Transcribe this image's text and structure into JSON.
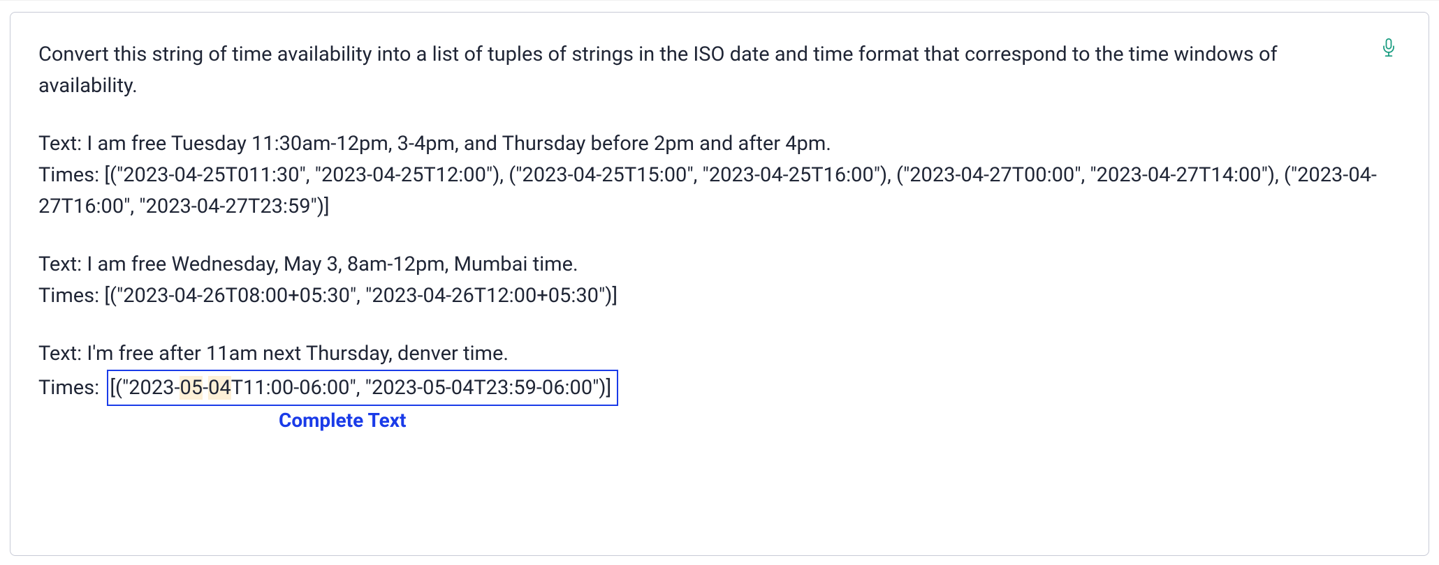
{
  "prompt": {
    "instruction": "Convert this string of time availability into a list of tuples of strings in the ISO date and time format that correspond to the time windows of availability.",
    "example1_text": "Text: I am free Tuesday 11:30am-12pm, 3-4pm, and Thursday before 2pm and after 4pm.",
    "example1_times": "Times: [(\"2023-04-25T011:30\", \"2023-04-25T12:00\"), (\"2023-04-25T15:00\", \"2023-04-25T16:00\"), (\"2023-04-27T00:00\", \"2023-04-27T14:00\"), (\"2023-04-27T16:00\", \"2023-04-27T23:59\")]",
    "example2_text": "Text: I am free Wednesday, May 3, 8am-12pm, Mumbai time.",
    "example2_times": "Times: [(\"2023-04-26T08:00+05:30\", \"2023-04-26T12:00+05:30\")]",
    "example3_text": "Text: I'm free after 11am next Thursday, denver time.",
    "example3_times_label": "Times:",
    "completion": {
      "before": "[(\"2023-",
      "hl1": "05",
      "mid1": "-",
      "hl2": "04",
      "after": "T11:00-06:00\", \"2023-05-04T23:59-06:00\")]"
    }
  },
  "ui": {
    "complete_text_label": "Complete Text"
  }
}
